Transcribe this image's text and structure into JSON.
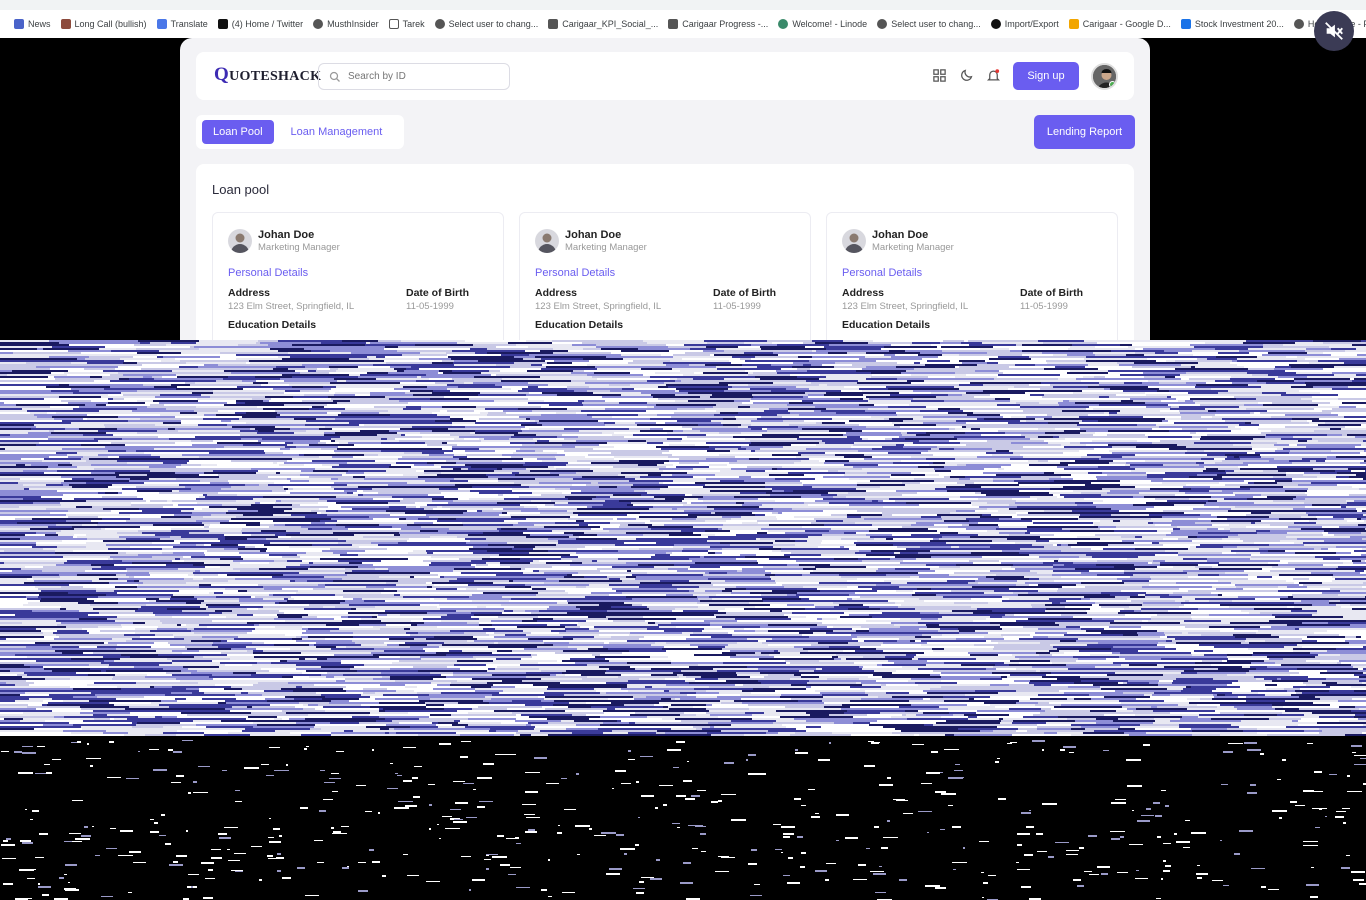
{
  "browser": {
    "bookmarks": [
      {
        "label": "News",
        "icon": "bookmark-icon",
        "color": "#4a63c9"
      },
      {
        "label": "Long Call (bullish)",
        "icon": "bookmark-icon",
        "color": "#8c4a3c"
      },
      {
        "label": "Translate",
        "icon": "translate-icon",
        "color": "#4a77e8"
      },
      {
        "label": "(4) Home / Twitter",
        "icon": "x-icon",
        "color": "#111111"
      },
      {
        "label": "MusthInsider",
        "icon": "globe-icon",
        "color": "#555555"
      },
      {
        "label": "Tarek",
        "icon": "folder-icon",
        "color": "#555555"
      },
      {
        "label": "Select user to chang...",
        "icon": "globe-icon",
        "color": "#555555"
      },
      {
        "label": "Carigaar_KPI_Social_...",
        "icon": "sheet-icon",
        "color": "#555555"
      },
      {
        "label": "Carigaar Progress -...",
        "icon": "sheet-icon",
        "color": "#555555"
      },
      {
        "label": "Welcome! - Linode",
        "icon": "linode-icon",
        "color": "#3a8a6a"
      },
      {
        "label": "Select user to chang...",
        "icon": "globe-icon",
        "color": "#555555"
      },
      {
        "label": "Import/Export",
        "icon": "github-icon",
        "color": "#111111"
      },
      {
        "label": "Carigaar - Google D...",
        "icon": "drive-icon",
        "color": "#f2a600"
      },
      {
        "label": "Stock Investment 20...",
        "icon": "drive-icon",
        "color": "#1a73e8"
      },
      {
        "label": "Home Page - Projects",
        "icon": "globe-icon",
        "color": "#555555"
      }
    ]
  },
  "header": {
    "logo_first": "Q",
    "logo_rest": "UOTESHACK",
    "search_placeholder": "Search by ID",
    "signup_label": "Sign up"
  },
  "tabs": [
    {
      "label": "Loan Pool",
      "active": true
    },
    {
      "label": "Loan Management",
      "active": false
    }
  ],
  "lending_report_label": "Lending Report",
  "pool": {
    "title": "Loan pool",
    "cards": [
      {
        "name": "Johan Doe",
        "role": "Marketing Manager",
        "section": "Personal Details",
        "address_label": "Address",
        "address": "123 Elm Street, Springfield, IL",
        "dob_label": "Date of Birth",
        "dob": "11-05-1999",
        "education_label": "Education Details"
      },
      {
        "name": "Johan Doe",
        "role": "Marketing Manager",
        "section": "Personal Details",
        "address_label": "Address",
        "address": "123 Elm Street, Springfield, IL",
        "dob_label": "Date of Birth",
        "dob": "11-05-1999",
        "education_label": "Education Details"
      },
      {
        "name": "Johan Doe",
        "role": "Marketing Manager",
        "section": "Personal Details",
        "address_label": "Address",
        "address": "123 Elm Street, Springfield, IL",
        "dob_label": "Date of Birth",
        "dob": "11-05-1999",
        "education_label": "Education Details"
      }
    ]
  },
  "colors": {
    "accent": "#6a5df0",
    "logo": "#3d2bb3",
    "page_bg": "#f3f3f6"
  }
}
